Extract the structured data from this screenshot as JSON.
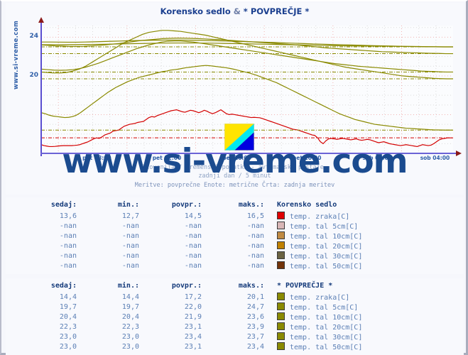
{
  "site": {
    "vertical_url": "www.si-vreme.com",
    "watermark": "www.si-vreme.com"
  },
  "chart_header": {
    "title_left": "Korensko sedlo",
    "title_sep": "&",
    "title_right": "* POVPREČJE *"
  },
  "subtitle": {
    "line1": "Slovenija / vremenski podatki - avtomatske postaje.",
    "line2": "zadnji dan / 5 minut",
    "line3": "Meritve: povprečne  Enote: metrične  Črta: zadnja meritev"
  },
  "chart_data": {
    "type": "line",
    "title": "Korensko sedlo & * POVPREČJE *",
    "xlabel": "",
    "ylabel": "",
    "ylim": [
      12,
      25.2
    ],
    "xlim": [
      0,
      288
    ],
    "grid": true,
    "yticks": [
      20,
      24
    ],
    "ytick_labels": [
      "20",
      "24"
    ],
    "xtick_labels": [
      "pet 08:00",
      "pet 12:00",
      "pet 16:00",
      "pet 20:00",
      "sob 00:00",
      "sob 04:00"
    ],
    "xtick_positions": [
      0.145,
      0.315,
      0.485,
      0.655,
      0.825,
      0.965
    ],
    "colors": {
      "air_red": "#d40000",
      "soil_olive": "#8a8a00",
      "axis": "#5b4fd0",
      "grid_pink": "#f0b0b0",
      "grid_gray": "#d8d8d8",
      "text_blue": "#2f5fa8"
    },
    "series": [
      {
        "name": "Korensko sedlo temp. zraka[C]",
        "color": "#d40000",
        "last_value": 13.6,
        "points": [
          12.9,
          12.8,
          12.75,
          12.7,
          12.7,
          12.72,
          12.75,
          12.78,
          12.8,
          12.8,
          12.8,
          12.8,
          12.82,
          12.85,
          12.9,
          13.0,
          13.1,
          13.2,
          13.35,
          13.5,
          13.6,
          13.55,
          13.7,
          13.9,
          14.0,
          14.1,
          14.3,
          14.35,
          14.4,
          14.6,
          14.8,
          14.9,
          15.0,
          15.05,
          15.1,
          15.2,
          15.25,
          15.3,
          15.5,
          15.7,
          15.8,
          15.75,
          15.9,
          16.0,
          16.1,
          16.2,
          16.3,
          16.4,
          16.45,
          16.5,
          16.4,
          16.3,
          16.25,
          16.35,
          16.45,
          16.4,
          16.3,
          16.2,
          16.3,
          16.45,
          16.35,
          16.2,
          16.1,
          16.2,
          16.35,
          16.5,
          16.3,
          16.1,
          16.0,
          16.05,
          16.0,
          15.95,
          15.9,
          15.85,
          15.8,
          15.75,
          15.7,
          15.72,
          15.7,
          15.68,
          15.6,
          15.5,
          15.4,
          15.3,
          15.2,
          15.1,
          15.0,
          14.9,
          14.8,
          14.7,
          14.6,
          14.5,
          14.45,
          14.4,
          14.3,
          14.2,
          14.1,
          14.0,
          13.9,
          13.85,
          13.6,
          13.2,
          13.0,
          13.3,
          13.5,
          13.55,
          13.5,
          13.45,
          13.5,
          13.55,
          13.5,
          13.45,
          13.4,
          13.45,
          13.5,
          13.4,
          13.35,
          13.4,
          13.45,
          13.4,
          13.3,
          13.2,
          13.1,
          13.15,
          13.2,
          13.1,
          13.0,
          12.95,
          12.9,
          12.85,
          12.8,
          12.85,
          12.9,
          12.85,
          12.8,
          12.75,
          12.7,
          12.8,
          12.9,
          12.85,
          12.8,
          12.85,
          13.0,
          13.2,
          13.4,
          13.5,
          13.55,
          13.6,
          13.6,
          13.6
        ]
      },
      {
        "name": "POVPREČJE temp. zraka[C]",
        "color": "#8a8a00",
        "last_value": 14.4,
        "points": [
          16.2,
          16.1,
          15.95,
          15.85,
          15.8,
          15.75,
          15.7,
          15.72,
          15.8,
          15.95,
          16.2,
          16.5,
          16.8,
          17.1,
          17.4,
          17.7,
          18.0,
          18.3,
          18.55,
          18.8,
          19.0,
          19.2,
          19.4,
          19.55,
          19.7,
          19.85,
          19.95,
          20.05,
          20.15,
          20.25,
          20.35,
          20.45,
          20.5,
          20.6,
          20.65,
          20.7,
          20.78,
          20.85,
          20.9,
          20.95,
          21.0,
          21.05,
          21.08,
          21.05,
          21.0,
          20.95,
          20.9,
          20.85,
          20.78,
          20.7,
          20.6,
          20.5,
          20.4,
          20.3,
          20.18,
          20.05,
          19.9,
          19.75,
          19.6,
          19.45,
          19.3,
          19.1,
          18.9,
          18.7,
          18.5,
          18.3,
          18.1,
          17.9,
          17.7,
          17.5,
          17.3,
          17.1,
          16.9,
          16.7,
          16.5,
          16.3,
          16.1,
          15.95,
          15.8,
          15.65,
          15.5,
          15.4,
          15.3,
          15.2,
          15.1,
          15.0,
          14.95,
          14.9,
          14.85,
          14.8,
          14.75,
          14.7,
          14.65,
          14.6,
          14.58,
          14.55,
          14.52,
          14.5,
          14.48,
          14.45,
          14.43,
          14.42,
          14.41,
          14.4,
          14.4,
          14.4
        ]
      },
      {
        "name": "POVPREČJE temp. tal 5cm[C]",
        "color": "#8a8a00",
        "last_value": 19.7,
        "points": [
          20.4,
          20.35,
          20.3,
          20.3,
          20.35,
          20.5,
          20.7,
          21.0,
          21.4,
          21.8,
          22.2,
          22.6,
          23.0,
          23.4,
          23.7,
          24.0,
          24.3,
          24.5,
          24.6,
          24.7,
          24.7,
          24.65,
          24.6,
          24.5,
          24.4,
          24.3,
          24.2,
          24.05,
          23.9,
          23.75,
          23.6,
          23.45,
          23.3,
          23.15,
          23.0,
          22.85,
          22.7,
          22.55,
          22.4,
          22.25,
          22.1,
          21.95,
          21.8,
          21.65,
          21.5,
          21.35,
          21.2,
          21.05,
          20.9,
          20.8,
          20.7,
          20.6,
          20.5,
          20.4,
          20.3,
          20.2,
          20.1,
          20.0,
          19.95,
          19.9,
          19.85,
          19.8,
          19.75,
          19.72,
          19.7,
          19.7
        ]
      },
      {
        "name": "POVPREČJE temp. tal 10cm[C]",
        "color": "#8a8a00",
        "last_value": 20.4,
        "points": [
          20.7,
          20.65,
          20.6,
          20.58,
          20.6,
          20.65,
          20.75,
          20.9,
          21.1,
          21.3,
          21.55,
          21.8,
          22.05,
          22.3,
          22.55,
          22.8,
          23.0,
          23.2,
          23.35,
          23.5,
          23.58,
          23.6,
          23.6,
          23.55,
          23.5,
          23.4,
          23.3,
          23.2,
          23.1,
          23.0,
          22.9,
          22.8,
          22.7,
          22.6,
          22.5,
          22.4,
          22.3,
          22.2,
          22.1,
          22.0,
          21.9,
          21.8,
          21.7,
          21.6,
          21.5,
          21.4,
          21.3,
          21.22,
          21.15,
          21.08,
          21.0,
          20.95,
          20.9,
          20.85,
          20.8,
          20.75,
          20.7,
          20.65,
          20.6,
          20.55,
          20.5,
          20.47,
          20.45,
          20.42,
          20.4,
          20.4
        ]
      },
      {
        "name": "POVPREČJE temp. tal 20cm[C]",
        "color": "#8a8a00",
        "last_value": 22.3,
        "points": [
          23.2,
          23.15,
          23.1,
          23.08,
          23.05,
          23.05,
          23.06,
          23.1,
          23.15,
          23.2,
          23.28,
          23.35,
          23.45,
          23.55,
          23.65,
          23.72,
          23.78,
          23.85,
          23.88,
          23.9,
          23.9,
          23.88,
          23.85,
          23.82,
          23.78,
          23.75,
          23.7,
          23.65,
          23.6,
          23.55,
          23.5,
          23.45,
          23.4,
          23.35,
          23.3,
          23.25,
          23.2,
          23.12,
          23.05,
          22.98,
          22.9,
          22.85,
          22.8,
          22.75,
          22.7,
          22.65,
          22.6,
          22.55,
          22.5,
          22.48,
          22.45,
          22.42,
          22.4,
          22.38,
          22.35,
          22.33,
          22.32,
          22.3,
          22.3
        ]
      },
      {
        "name": "POVPREČJE temp. tal 30cm[C]",
        "color": "#8a8a00",
        "last_value": 23.0,
        "points": [
          23.5,
          23.5,
          23.49,
          23.48,
          23.48,
          23.5,
          23.52,
          23.55,
          23.58,
          23.6,
          23.63,
          23.65,
          23.67,
          23.69,
          23.7,
          23.7,
          23.7,
          23.69,
          23.67,
          23.65,
          23.63,
          23.6,
          23.58,
          23.55,
          23.52,
          23.5,
          23.47,
          23.44,
          23.4,
          23.37,
          23.34,
          23.3,
          23.28,
          23.25,
          23.22,
          23.2,
          23.18,
          23.15,
          23.12,
          23.1,
          23.08,
          23.06,
          23.05,
          23.04,
          23.02,
          23.01,
          23.0,
          23.0
        ]
      },
      {
        "name": "POVPREČJE temp. tal 50cm[C]",
        "color": "#8a8a00",
        "last_value": 23.0,
        "points": [
          23.22,
          23.22,
          23.22,
          23.23,
          23.24,
          23.25,
          23.26,
          23.28,
          23.3,
          23.32,
          23.34,
          23.36,
          23.38,
          23.39,
          23.4,
          23.4,
          23.4,
          23.39,
          23.38,
          23.36,
          23.34,
          23.32,
          23.3,
          23.28,
          23.26,
          23.24,
          23.22,
          23.2,
          23.18,
          23.16,
          23.14,
          23.12,
          23.1,
          23.09,
          23.08,
          23.07,
          23.06,
          23.05,
          23.04,
          23.03,
          23.02,
          23.01,
          23.0,
          23.0
        ]
      }
    ],
    "last_measurement_lines": [
      {
        "value": 13.6,
        "color": "#d40000",
        "style": "dashdot"
      },
      {
        "value": 14.4,
        "color": "#8a8a00",
        "style": "dashdot"
      },
      {
        "value": 19.7,
        "color": "#8a8a00",
        "style": "dashdot"
      },
      {
        "value": 20.4,
        "color": "#8a8a00",
        "style": "dashdot"
      },
      {
        "value": 22.3,
        "color": "#8a8a00",
        "style": "dashdot"
      },
      {
        "value": 23.0,
        "color": "#8a8a00",
        "style": "dashdot"
      }
    ]
  },
  "tables": [
    {
      "station": "Korensko sedlo",
      "headers": [
        "sedaj:",
        "min.:",
        "povpr.:",
        "maks.:"
      ],
      "rows": [
        {
          "sedaj": "13,6",
          "min": "12,7",
          "povpr": "14,5",
          "maks": "16,5",
          "color": "#e00000",
          "label": "temp. zraka[C]"
        },
        {
          "sedaj": "-nan",
          "min": "-nan",
          "povpr": "-nan",
          "maks": "-nan",
          "color": "#d8b6b6",
          "label": "temp. tal  5cm[C]"
        },
        {
          "sedaj": "-nan",
          "min": "-nan",
          "povpr": "-nan",
          "maks": "-nan",
          "color": "#c08a42",
          "label": "temp. tal 10cm[C]"
        },
        {
          "sedaj": "-nan",
          "min": "-nan",
          "povpr": "-nan",
          "maks": "-nan",
          "color": "#c08000",
          "label": "temp. tal 20cm[C]"
        },
        {
          "sedaj": "-nan",
          "min": "-nan",
          "povpr": "-nan",
          "maks": "-nan",
          "color": "#6b6342",
          "label": "temp. tal 30cm[C]"
        },
        {
          "sedaj": "-nan",
          "min": "-nan",
          "povpr": "-nan",
          "maks": "-nan",
          "color": "#73340a",
          "label": "temp. tal 50cm[C]"
        }
      ]
    },
    {
      "station": "* POVPREČJE *",
      "headers": [
        "sedaj:",
        "min.:",
        "povpr.:",
        "maks.:"
      ],
      "rows": [
        {
          "sedaj": "14,4",
          "min": "14,4",
          "povpr": "17,2",
          "maks": "20,1",
          "color": "#8a8a00",
          "label": "temp. zraka[C]"
        },
        {
          "sedaj": "19,7",
          "min": "19,7",
          "povpr": "22,0",
          "maks": "24,7",
          "color": "#8a8a00",
          "label": "temp. tal  5cm[C]"
        },
        {
          "sedaj": "20,4",
          "min": "20,4",
          "povpr": "21,9",
          "maks": "23,6",
          "color": "#8a8a00",
          "label": "temp. tal 10cm[C]"
        },
        {
          "sedaj": "22,3",
          "min": "22,3",
          "povpr": "23,1",
          "maks": "23,9",
          "color": "#8a8a00",
          "label": "temp. tal 20cm[C]"
        },
        {
          "sedaj": "23,0",
          "min": "23,0",
          "povpr": "23,4",
          "maks": "23,7",
          "color": "#8a8a00",
          "label": "temp. tal 30cm[C]"
        },
        {
          "sedaj": "23,0",
          "min": "23,0",
          "povpr": "23,1",
          "maks": "23,4",
          "color": "#8a8a00",
          "label": "temp. tal 50cm[C]"
        }
      ]
    }
  ]
}
